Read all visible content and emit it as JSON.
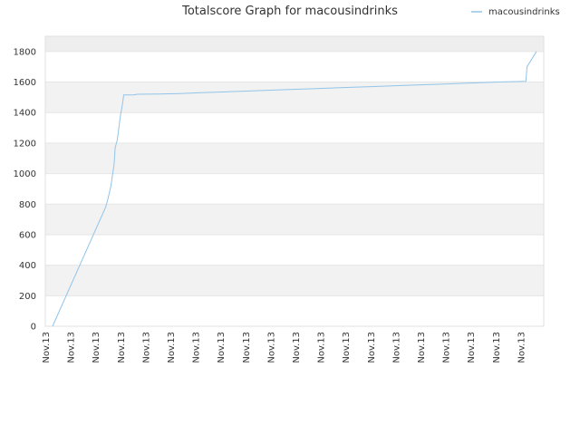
{
  "chart_data": {
    "type": "line",
    "title": "Totalscore Graph for macousindrinks",
    "xlabel": "",
    "ylabel": "",
    "ylim": [
      0,
      1900
    ],
    "y_ticks": [
      0,
      200,
      400,
      600,
      800,
      1000,
      1200,
      1400,
      1600,
      1800
    ],
    "y_tick_labels": [
      "0",
      "200",
      "400",
      "600",
      "800",
      "1000",
      "1200",
      "1400",
      "1600",
      "1800"
    ],
    "x_tick_labels": [
      "Nov.13",
      "Nov.13",
      "Nov.13",
      "Nov.13",
      "Nov.13",
      "Nov.13",
      "Nov.13",
      "Nov.13",
      "Nov.13",
      "Nov.13",
      "Nov.13",
      "Nov.13",
      "Nov.13",
      "Nov.13",
      "Nov.13",
      "Nov.13",
      "Nov.13",
      "Nov.13",
      "Nov.13",
      "Nov.13"
    ],
    "grid": "horizontal bands",
    "legend_position": "top-right",
    "series": [
      {
        "name": "macousindrinks",
        "color": "#92c4e9",
        "points": [
          [
            0.0,
            0
          ],
          [
            2.5,
            780
          ],
          [
            2.6,
            830
          ],
          [
            2.75,
            920
          ],
          [
            2.9,
            1060
          ],
          [
            2.95,
            1170
          ],
          [
            3.05,
            1220
          ],
          [
            3.2,
            1380
          ],
          [
            3.3,
            1460
          ],
          [
            3.35,
            1515
          ],
          [
            3.8,
            1515
          ],
          [
            4.0,
            1520
          ],
          [
            5.0,
            1522
          ],
          [
            6.0,
            1525
          ],
          [
            7.0,
            1530
          ],
          [
            8.0,
            1535
          ],
          [
            9.0,
            1540
          ],
          [
            10.0,
            1545
          ],
          [
            11.0,
            1550
          ],
          [
            12.0,
            1555
          ],
          [
            13.0,
            1560
          ],
          [
            14.0,
            1565
          ],
          [
            15.0,
            1570
          ],
          [
            16.0,
            1575
          ],
          [
            17.0,
            1580
          ],
          [
            18.0,
            1585
          ],
          [
            19.0,
            1590
          ],
          [
            20.0,
            1595
          ],
          [
            21.0,
            1600
          ],
          [
            22.3,
            1605
          ],
          [
            22.35,
            1700
          ],
          [
            22.8,
            1800
          ]
        ]
      }
    ]
  }
}
